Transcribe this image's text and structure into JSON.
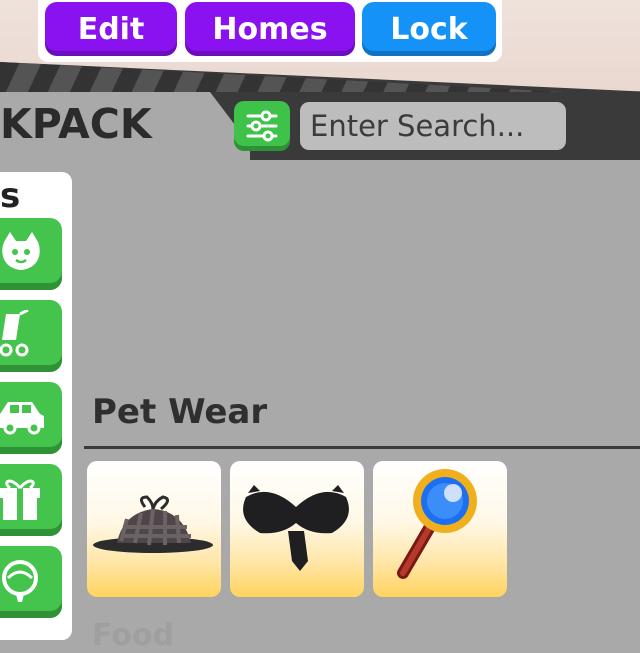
{
  "top_menu": {
    "edit_label": "Edit",
    "homes_label": "Homes",
    "lock_label": "Lock"
  },
  "backpack": {
    "title": "KPACK",
    "search_placeholder": "Enter Search...",
    "sidebar_heading": "s",
    "categories": [
      "pets-icon",
      "strollers-icon",
      "vehicles-icon",
      "gifts-icon",
      "toys-icon"
    ],
    "section_title": "Pet Wear",
    "items": [
      {
        "icon": "detective-hat-icon"
      },
      {
        "icon": "mustache-icon"
      },
      {
        "icon": "magnifying-glass-icon"
      }
    ],
    "next_section": "Food"
  },
  "colors": {
    "purple": "#8a12f0",
    "blue": "#1592f7",
    "green": "#44c44c",
    "panel_gray": "#a9a9a9",
    "dark": "#3a3a3a"
  }
}
